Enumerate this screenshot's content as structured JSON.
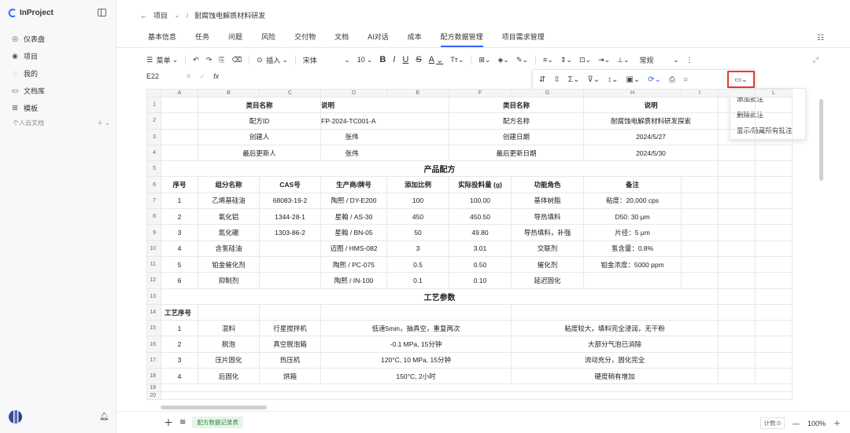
{
  "app": {
    "name": "InProject"
  },
  "sidebar": {
    "items": [
      {
        "icon": "dashboard-icon",
        "label": "仪表盘"
      },
      {
        "icon": "project-icon",
        "label": "项目"
      },
      {
        "icon": "user-icon",
        "label": "我的"
      },
      {
        "icon": "folder-icon",
        "label": "文档库"
      },
      {
        "icon": "template-icon",
        "label": "模板"
      }
    ],
    "personal_cloud": "个人云文档"
  },
  "breadcrumb": {
    "root": "项目",
    "current": "耐腐蚀电解质材料研发"
  },
  "tabs": [
    "基本信息",
    "任务",
    "问题",
    "风险",
    "交付物",
    "文档",
    "AI对话",
    "成本",
    "配方数据管理",
    "项目需求管理"
  ],
  "active_tab": "配方数据管理",
  "toolbar": {
    "menu": "菜单",
    "insert": "插入",
    "font": "宋体",
    "size": "10",
    "bold": "B",
    "italic": "I",
    "underline": "U",
    "strike": "S",
    "color": "A",
    "format": "常规"
  },
  "formula_bar": {
    "cell": "E22",
    "fx": "fx"
  },
  "comment_menu": [
    "添加批注",
    "删除批注",
    "显示/隐藏所有批注"
  ],
  "sheet": {
    "columns": [
      "A",
      "B",
      "C",
      "D",
      "E",
      "F",
      "G",
      "H",
      "I",
      "L"
    ],
    "rows": [
      [
        "1",
        "",
        "类目名称",
        "说明",
        "",
        "类目名称",
        "说明",
        "",
        "",
        ""
      ],
      [
        "2",
        "",
        "配方ID",
        "FP-2024-TC001-A",
        "",
        "配方名称",
        "耐腐蚀电解质材料研发探索",
        "",
        "",
        ""
      ],
      [
        "3",
        "",
        "创建人",
        "张伟",
        "",
        "创建日期",
        "2024/5/27",
        "",
        "",
        ""
      ],
      [
        "4",
        "",
        "最后更新人",
        "张伟",
        "",
        "最后更新日期",
        "2024/5/30",
        "",
        "",
        ""
      ],
      [
        "5",
        "",
        "产品配方",
        "",
        "",
        "",
        "",
        "",
        "",
        ""
      ],
      [
        "6",
        "序号",
        "组分名称",
        "CAS号",
        "生产商/牌号",
        "添加比例",
        "实际投料量 (g)",
        "功能角色",
        "备注",
        "",
        ""
      ],
      [
        "7",
        "1",
        "乙烯基硅油",
        "68083-19-2",
        "陶熙 / DY-E200",
        "100",
        "100.00",
        "基体树脂",
        "粘度：20,000 cps",
        "",
        ""
      ],
      [
        "8",
        "2",
        "氧化铝",
        "1344-28-1",
        "星翰 / AS-30",
        "450",
        "450.50",
        "导热填料",
        "D50: 30 μm",
        "",
        ""
      ],
      [
        "9",
        "3",
        "氮化硼",
        "1303-86-2",
        "星翰 / BN-05",
        "50",
        "49.80",
        "导热填料，补强",
        "片径：5 μm",
        "",
        ""
      ],
      [
        "10",
        "4",
        "含氢硅油",
        "",
        "迈图 / HMS-082",
        "3",
        "3.01",
        "交联剂",
        "氢含量：0.8%",
        "",
        ""
      ],
      [
        "11",
        "5",
        "铂金催化剂",
        "",
        "陶熙 / PC-075",
        "0.5",
        "0.50",
        "催化剂",
        "铂金浓度：5000 ppm",
        "",
        ""
      ],
      [
        "12",
        "6",
        "抑制剂",
        "",
        "陶熙 / IN-100",
        "0.1",
        "0.10",
        "延迟固化",
        "",
        "",
        ""
      ],
      [
        "13",
        "工艺参数"
      ],
      [
        "14",
        "工艺序号"
      ],
      [
        "15",
        "1",
        "混料",
        "行星搅拌机",
        "低速5min，抽真空，重复两次",
        "粘度较大，填料完全浸润，无干粉"
      ],
      [
        "16",
        "2",
        "脱泡",
        "真空脱泡箱",
        "-0.1 MPa, 15分钟",
        "大部分气泡已消除"
      ],
      [
        "17",
        "3",
        "压片固化",
        "热压机",
        "120°C, 10 MPa, 15分钟",
        "流动充分，固化完全"
      ],
      [
        "18",
        "4",
        "后固化",
        "烘箱",
        "150°C, 2小时",
        "硬度稍有增加"
      ],
      [
        "19"
      ],
      [
        "20"
      ]
    ]
  },
  "bottom": {
    "sheet_name": "配方数据记录表",
    "count": "计数:0",
    "zoom": "100%"
  }
}
